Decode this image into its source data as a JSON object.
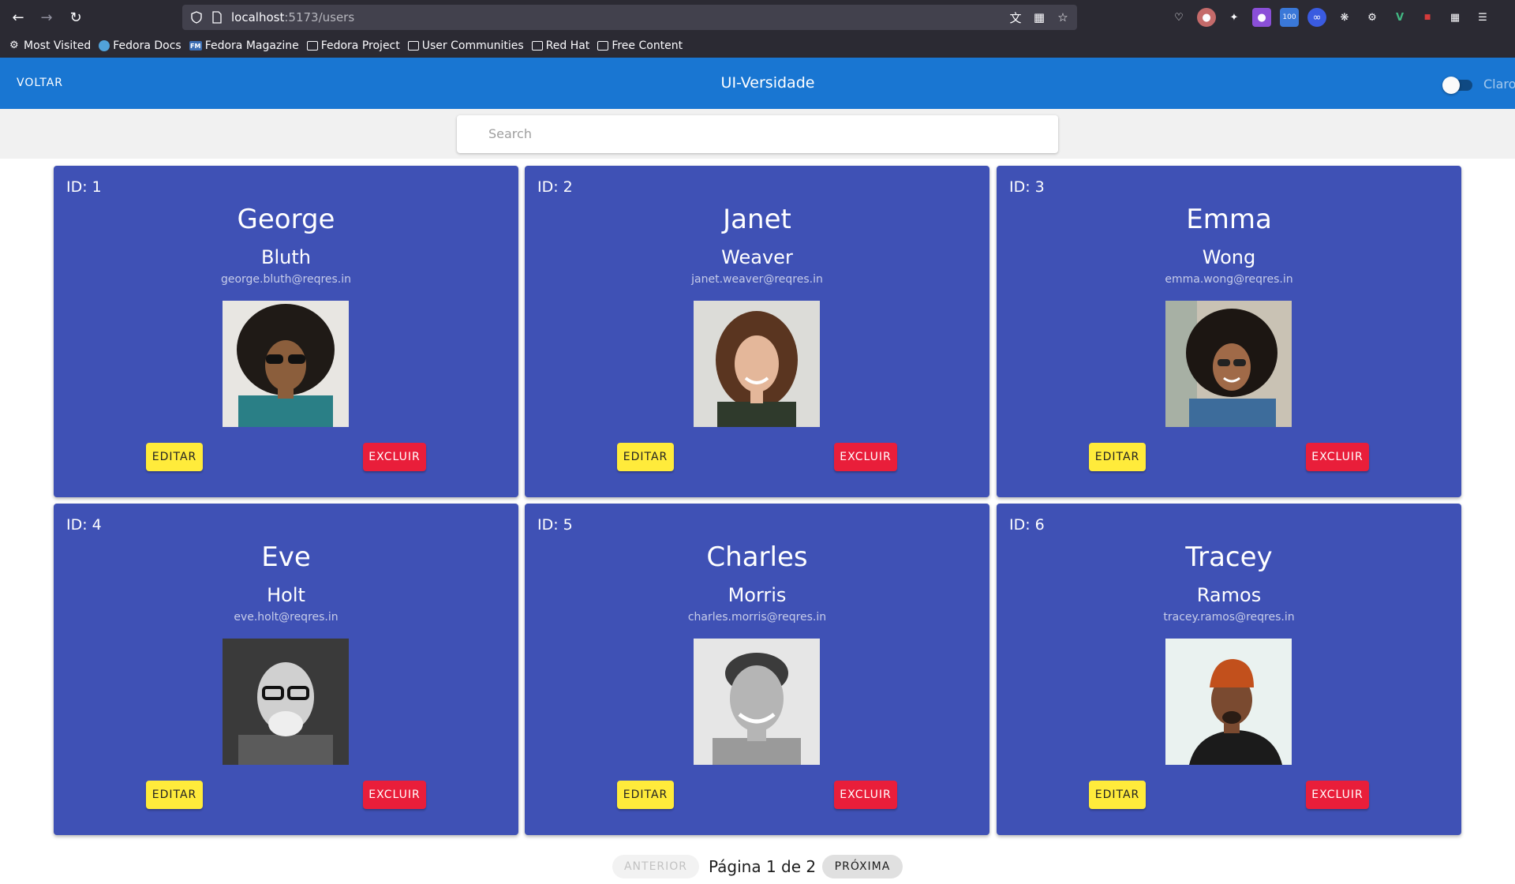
{
  "browser": {
    "url_host": "localhost",
    "url_path": ":5173/users",
    "bookmarks": [
      {
        "label": "Most Visited",
        "icon": "gear-icon"
      },
      {
        "label": "Fedora Docs",
        "icon": "fedora-icon"
      },
      {
        "label": "Fedora Magazine",
        "icon": "fm-icon"
      },
      {
        "label": "Fedora Project",
        "icon": "folder-icon"
      },
      {
        "label": "User Communities",
        "icon": "folder-icon"
      },
      {
        "label": "Red Hat",
        "icon": "folder-icon"
      },
      {
        "label": "Free Content",
        "icon": "folder-icon"
      }
    ]
  },
  "appbar": {
    "back_label": "VOLTAR",
    "title": "UI-Versidade",
    "theme_label": "Claro"
  },
  "search": {
    "placeholder": "Search"
  },
  "users": [
    {
      "id_label": "ID: 1",
      "first_name": "George",
      "last_name": "Bluth",
      "email": "george.bluth@reqres.in"
    },
    {
      "id_label": "ID: 2",
      "first_name": "Janet",
      "last_name": "Weaver",
      "email": "janet.weaver@reqres.in"
    },
    {
      "id_label": "ID: 3",
      "first_name": "Emma",
      "last_name": "Wong",
      "email": "emma.wong@reqres.in"
    },
    {
      "id_label": "ID: 4",
      "first_name": "Eve",
      "last_name": "Holt",
      "email": "eve.holt@reqres.in"
    },
    {
      "id_label": "ID: 5",
      "first_name": "Charles",
      "last_name": "Morris",
      "email": "charles.morris@reqres.in"
    },
    {
      "id_label": "ID: 6",
      "first_name": "Tracey",
      "last_name": "Ramos",
      "email": "tracey.ramos@reqres.in"
    }
  ],
  "card_actions": {
    "edit_label": "EDITAR",
    "delete_label": "EXCLUIR"
  },
  "pagination": {
    "prev_label": "ANTERIOR",
    "page_text": "Página 1 de 2",
    "next_label": "PRÓXIMA"
  },
  "colors": {
    "appbar": "#1976d2",
    "card": "#3f51b5",
    "edit_button": "#ffeb3b",
    "delete_button": "#e91e3a"
  }
}
